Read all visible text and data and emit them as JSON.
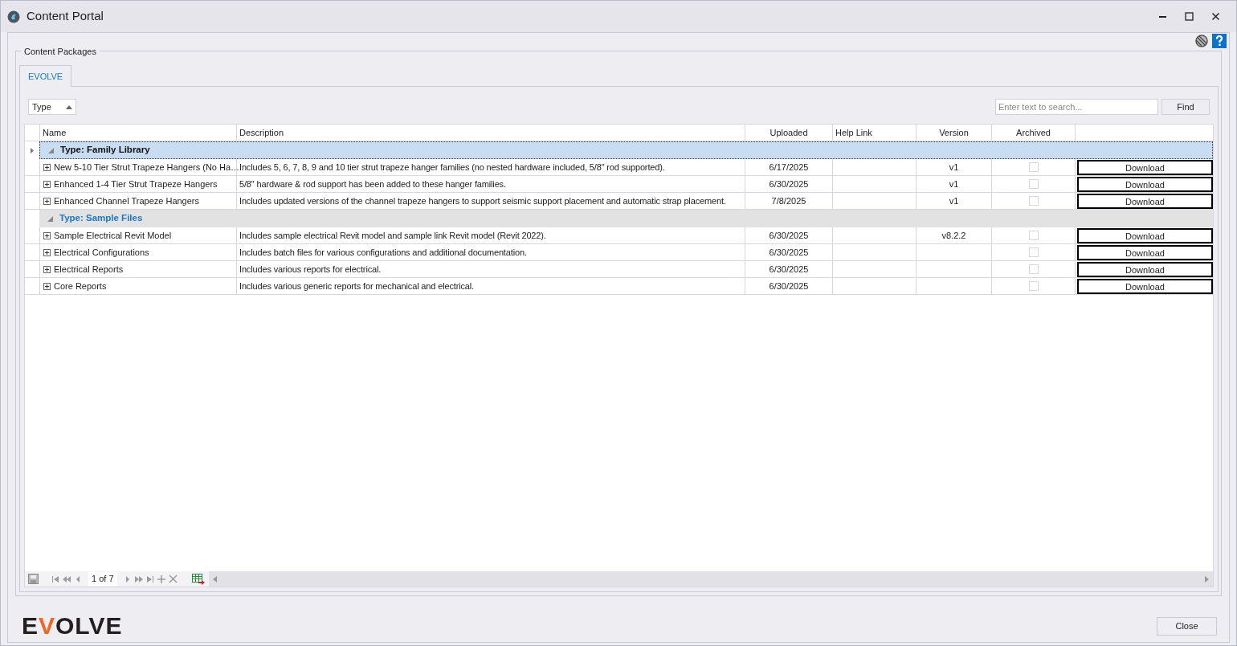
{
  "window": {
    "title": "Content Portal"
  },
  "section": {
    "title": "Content Packages"
  },
  "tabs": [
    {
      "label": "EVOLVE",
      "selected": true
    }
  ],
  "group_by": {
    "label": "Type"
  },
  "search": {
    "placeholder": "Enter text to search...",
    "button": "Find"
  },
  "table": {
    "columns": [
      "Name",
      "Description",
      "Uploaded",
      "Help Link",
      "Version",
      "Archived"
    ],
    "groups": [
      {
        "title": "Type: Family Library",
        "selected": true,
        "expanded": true,
        "rows": [
          {
            "name": "New 5-10 Tier Strut Trapeze Hangers (No Ha…",
            "description": "Includes 5, 6, 7, 8, 9 and 10 tier strut trapeze hanger families (no nested hardware included, 5/8\" rod supported).",
            "uploaded": "6/17/2025",
            "version": "v1",
            "archived": false,
            "expanded": false,
            "action": "Download"
          },
          {
            "name": "Enhanced 1-4 Tier Strut Trapeze Hangers",
            "description": "5/8\" hardware & rod support has been added to these hanger families.",
            "uploaded": "6/30/2025",
            "version": "v1",
            "archived": false,
            "expanded": false,
            "action": "Download"
          },
          {
            "name": "Enhanced Channel Trapeze Hangers",
            "description": "Includes updated versions of the channel trapeze hangers to support seismic support placement and automatic strap placement.",
            "uploaded": "7/8/2025",
            "version": "v1",
            "archived": false,
            "expanded": false,
            "action": "Download"
          }
        ]
      },
      {
        "title": "Type: Sample Files",
        "selected": false,
        "expanded": true,
        "rows": [
          {
            "name": "Sample Electrical Revit Model",
            "description": "Includes sample electrical Revit model and sample link Revit model (Revit 2022).",
            "uploaded": "6/30/2025",
            "version": "v8.2.2",
            "archived": false,
            "expanded": false,
            "action": "Download"
          },
          {
            "name": "Electrical Configurations",
            "description": "Includes batch files for various configurations and additional documentation.",
            "uploaded": "6/30/2025",
            "version": "",
            "archived": false,
            "expanded": false,
            "action": "Download"
          },
          {
            "name": "Electrical Reports",
            "description": "Includes various reports for electrical.",
            "uploaded": "6/30/2025",
            "version": "",
            "archived": false,
            "expanded": false,
            "action": "Download"
          },
          {
            "name": "Core Reports",
            "description": "Includes various generic reports for mechanical and electrical.",
            "uploaded": "6/30/2025",
            "version": "",
            "archived": false,
            "expanded": false,
            "action": "Download"
          }
        ]
      }
    ]
  },
  "navigator": {
    "page": "1 of 7"
  },
  "logo": [
    {
      "text": "E",
      "color": "#231f20"
    },
    {
      "text": "V",
      "color": "#f26522"
    },
    {
      "text": "OLVE",
      "color": "#231f20"
    }
  ],
  "close_button": "Close"
}
